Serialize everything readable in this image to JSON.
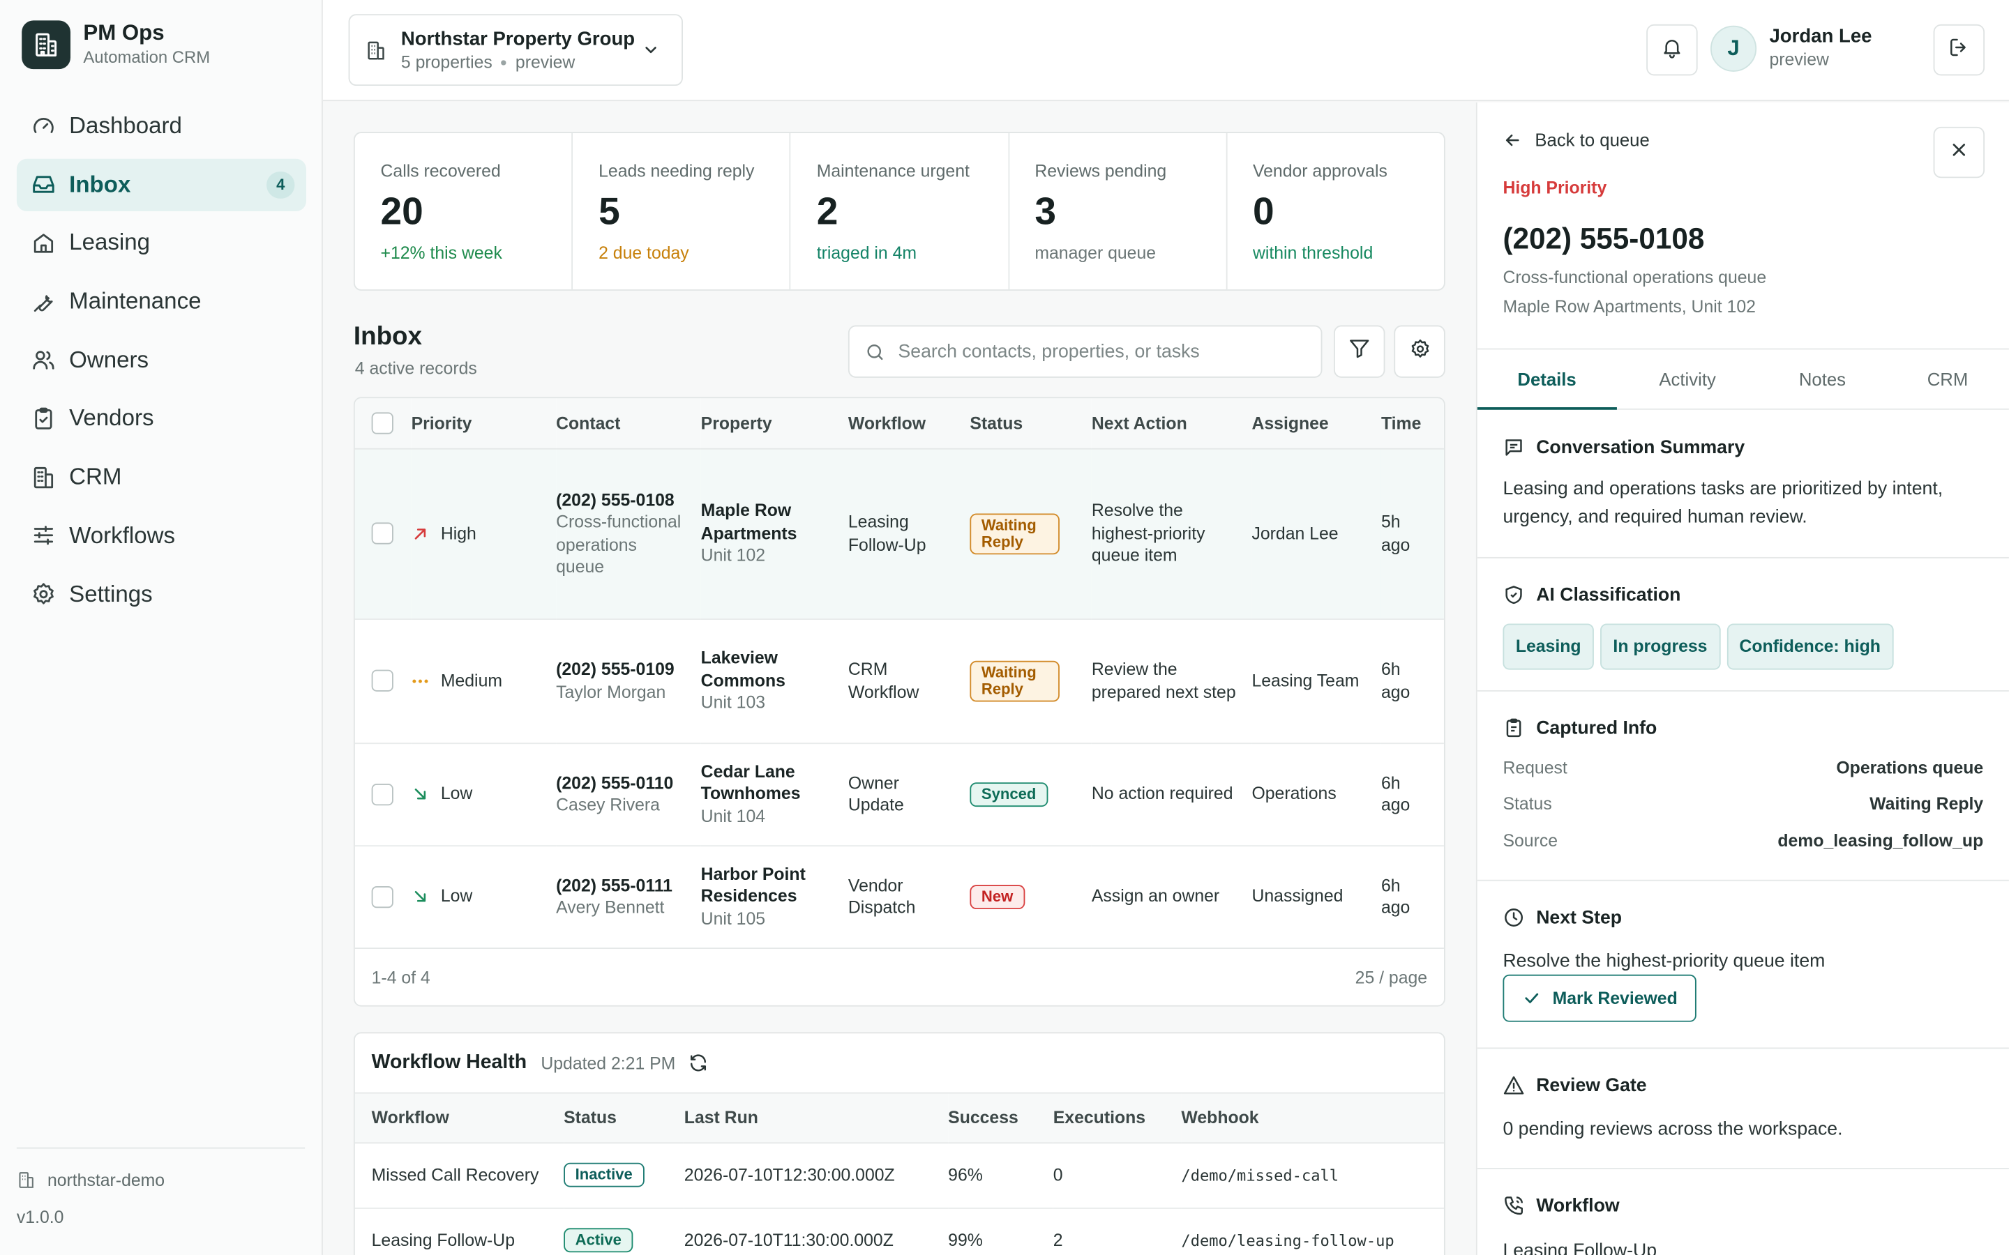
{
  "brand": {
    "name": "PM Ops",
    "subtitle": "Automation CRM"
  },
  "sidebar": {
    "items": [
      {
        "label": "Dashboard",
        "icon": "gauge-icon"
      },
      {
        "label": "Inbox",
        "icon": "inbox-icon",
        "badge": "4",
        "active": true
      },
      {
        "label": "Leasing",
        "icon": "home-icon"
      },
      {
        "label": "Maintenance",
        "icon": "wrench-icon"
      },
      {
        "label": "Owners",
        "icon": "users-icon"
      },
      {
        "label": "Vendors",
        "icon": "clipboard-check-icon"
      },
      {
        "label": "CRM",
        "icon": "building-icon"
      },
      {
        "label": "Workflows",
        "icon": "sliders-icon"
      },
      {
        "label": "Settings",
        "icon": "gear-icon"
      }
    ],
    "footer": {
      "org": "northstar-demo",
      "version": "v1.0.0"
    }
  },
  "topbar": {
    "org_name": "Northstar Property Group",
    "org_properties": "5 properties",
    "org_mode": "preview",
    "user_initial": "J",
    "user_name": "Jordan Lee",
    "user_role": "preview"
  },
  "kpis": [
    {
      "label": "Calls recovered",
      "value": "20",
      "note": "+12% this week",
      "tone": "green"
    },
    {
      "label": "Leads needing reply",
      "value": "5",
      "note": "2 due today",
      "tone": "amber"
    },
    {
      "label": "Maintenance urgent",
      "value": "2",
      "note": "triaged in 4m",
      "tone": "teal"
    },
    {
      "label": "Reviews pending",
      "value": "3",
      "note": "manager queue",
      "tone": "gray"
    },
    {
      "label": "Vendor approvals",
      "value": "0",
      "note": "within threshold",
      "tone": "teal2"
    }
  ],
  "inbox": {
    "title": "Inbox",
    "subtitle": "4 active records",
    "search_placeholder": "Search contacts, properties, or tasks",
    "columns": [
      "Priority",
      "Contact",
      "Property",
      "Workflow",
      "Status",
      "Next Action",
      "Assignee",
      "Time"
    ],
    "rows": [
      {
        "priority": "High",
        "phone": "(202) 555-0108",
        "contact": "Cross-functional operations queue",
        "property": "Maple Row Apartments",
        "unit": "Unit 102",
        "workflow": "Leasing Follow-Up",
        "status": "Waiting Reply",
        "next_action": "Resolve the highest-priority queue item",
        "assignee": "Jordan Lee",
        "time": "5h ago"
      },
      {
        "priority": "Medium",
        "phone": "(202) 555-0109",
        "contact": "Taylor Morgan",
        "property": "Lakeview Commons",
        "unit": "Unit 103",
        "workflow": "CRM Workflow",
        "status": "Waiting Reply",
        "next_action": "Review the prepared next step",
        "assignee": "Leasing Team",
        "time": "6h ago"
      },
      {
        "priority": "Low",
        "phone": "(202) 555-0110",
        "contact": "Casey Rivera",
        "property": "Cedar Lane Townhomes",
        "unit": "Unit 104",
        "workflow": "Owner Update",
        "status": "Synced",
        "next_action": "No action required",
        "assignee": "Operations",
        "time": "6h ago"
      },
      {
        "priority": "Low",
        "phone": "(202) 555-0111",
        "contact": "Avery Bennett",
        "property": "Harbor Point Residences",
        "unit": "Unit 105",
        "workflow": "Vendor Dispatch",
        "status": "New",
        "next_action": "Assign an owner",
        "assignee": "Unassigned",
        "time": "6h ago"
      }
    ],
    "pagination": "1-4 of 4",
    "page_size": "25 / page"
  },
  "workflow_health": {
    "title": "Workflow Health",
    "updated": "Updated 2:21 PM",
    "columns": [
      "Workflow",
      "Status",
      "Last Run",
      "Success",
      "Executions",
      "Webhook"
    ],
    "rows": [
      {
        "name": "Missed Call Recovery",
        "status": "Inactive",
        "last_run": "2026-07-10T12:30:00.000Z",
        "success": "96%",
        "executions": "0",
        "webhook": "/demo/missed-call"
      },
      {
        "name": "Leasing Follow-Up",
        "status": "Active",
        "last_run": "2026-07-10T11:30:00.000Z",
        "success": "99%",
        "executions": "2",
        "webhook": "/demo/leasing-follow-up"
      }
    ]
  },
  "detail": {
    "back_label": "Back to queue",
    "priority": "High Priority",
    "title": "(202) 555-0108",
    "subtitle1": "Cross-functional operations queue",
    "subtitle2": "Maple Row Apartments, Unit 102",
    "tabs": [
      "Details",
      "Activity",
      "Notes",
      "CRM"
    ],
    "summary": {
      "title": "Conversation Summary",
      "body": "Leasing and operations tasks are prioritized by intent, urgency, and required human review."
    },
    "classification": {
      "title": "AI Classification",
      "chips": [
        "Leasing",
        "In progress",
        "Confidence: high"
      ]
    },
    "captured": {
      "title": "Captured Info",
      "fields": [
        {
          "key": "Request",
          "value": "Operations queue"
        },
        {
          "key": "Status",
          "value": "Waiting Reply"
        },
        {
          "key": "Source",
          "value": "demo_leasing_follow_up"
        }
      ]
    },
    "next_step": {
      "title": "Next Step",
      "body": "Resolve the highest-priority queue item",
      "button": "Mark Reviewed"
    },
    "review_gate": {
      "title": "Review Gate",
      "body": "0 pending reviews across the workspace."
    },
    "workflow": {
      "title": "Workflow",
      "body": "Leasing Follow-Up"
    }
  },
  "colors": {
    "accent": "#0d5d5a",
    "high": "#d63b3b",
    "medium": "#e39a1b",
    "low": "#1b8d5c"
  }
}
